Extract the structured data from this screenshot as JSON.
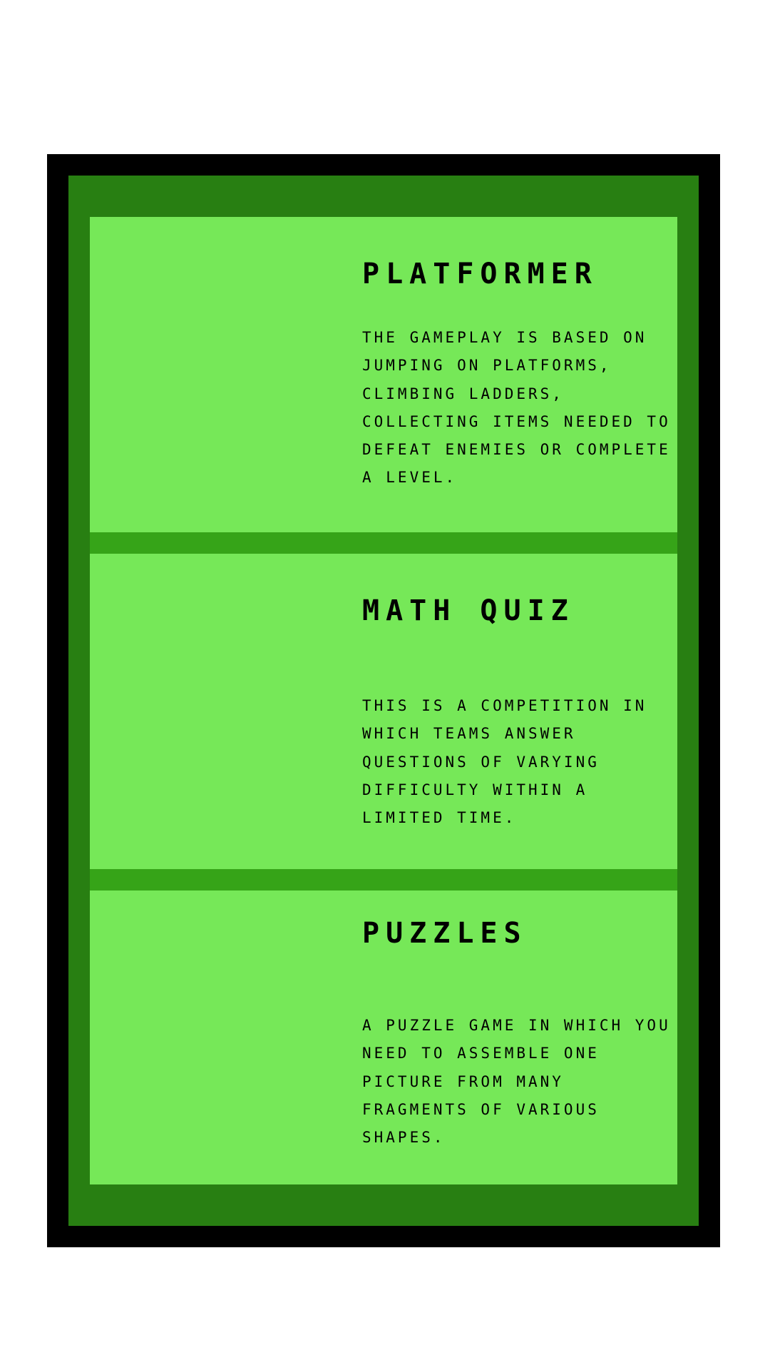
{
  "colors": {
    "background": "#ffffff",
    "outer_frame": "#000000",
    "inner_frame": "#287f12",
    "panel": "#76e858",
    "divider": "#36a418",
    "text": "#000000"
  },
  "games": [
    {
      "title": "platformer",
      "description": "the gameplay is based on jumping on platforms, climbing ladders, collecting items needed to defeat enemies or complete a level."
    },
    {
      "title": "math quiz",
      "description": "this is a competition in which teams answer questions of varying difficulty within a limited time."
    },
    {
      "title": "puzzles",
      "description": "a puzzle game in which you need to assemble one picture from many fragments of various shapes."
    }
  ]
}
